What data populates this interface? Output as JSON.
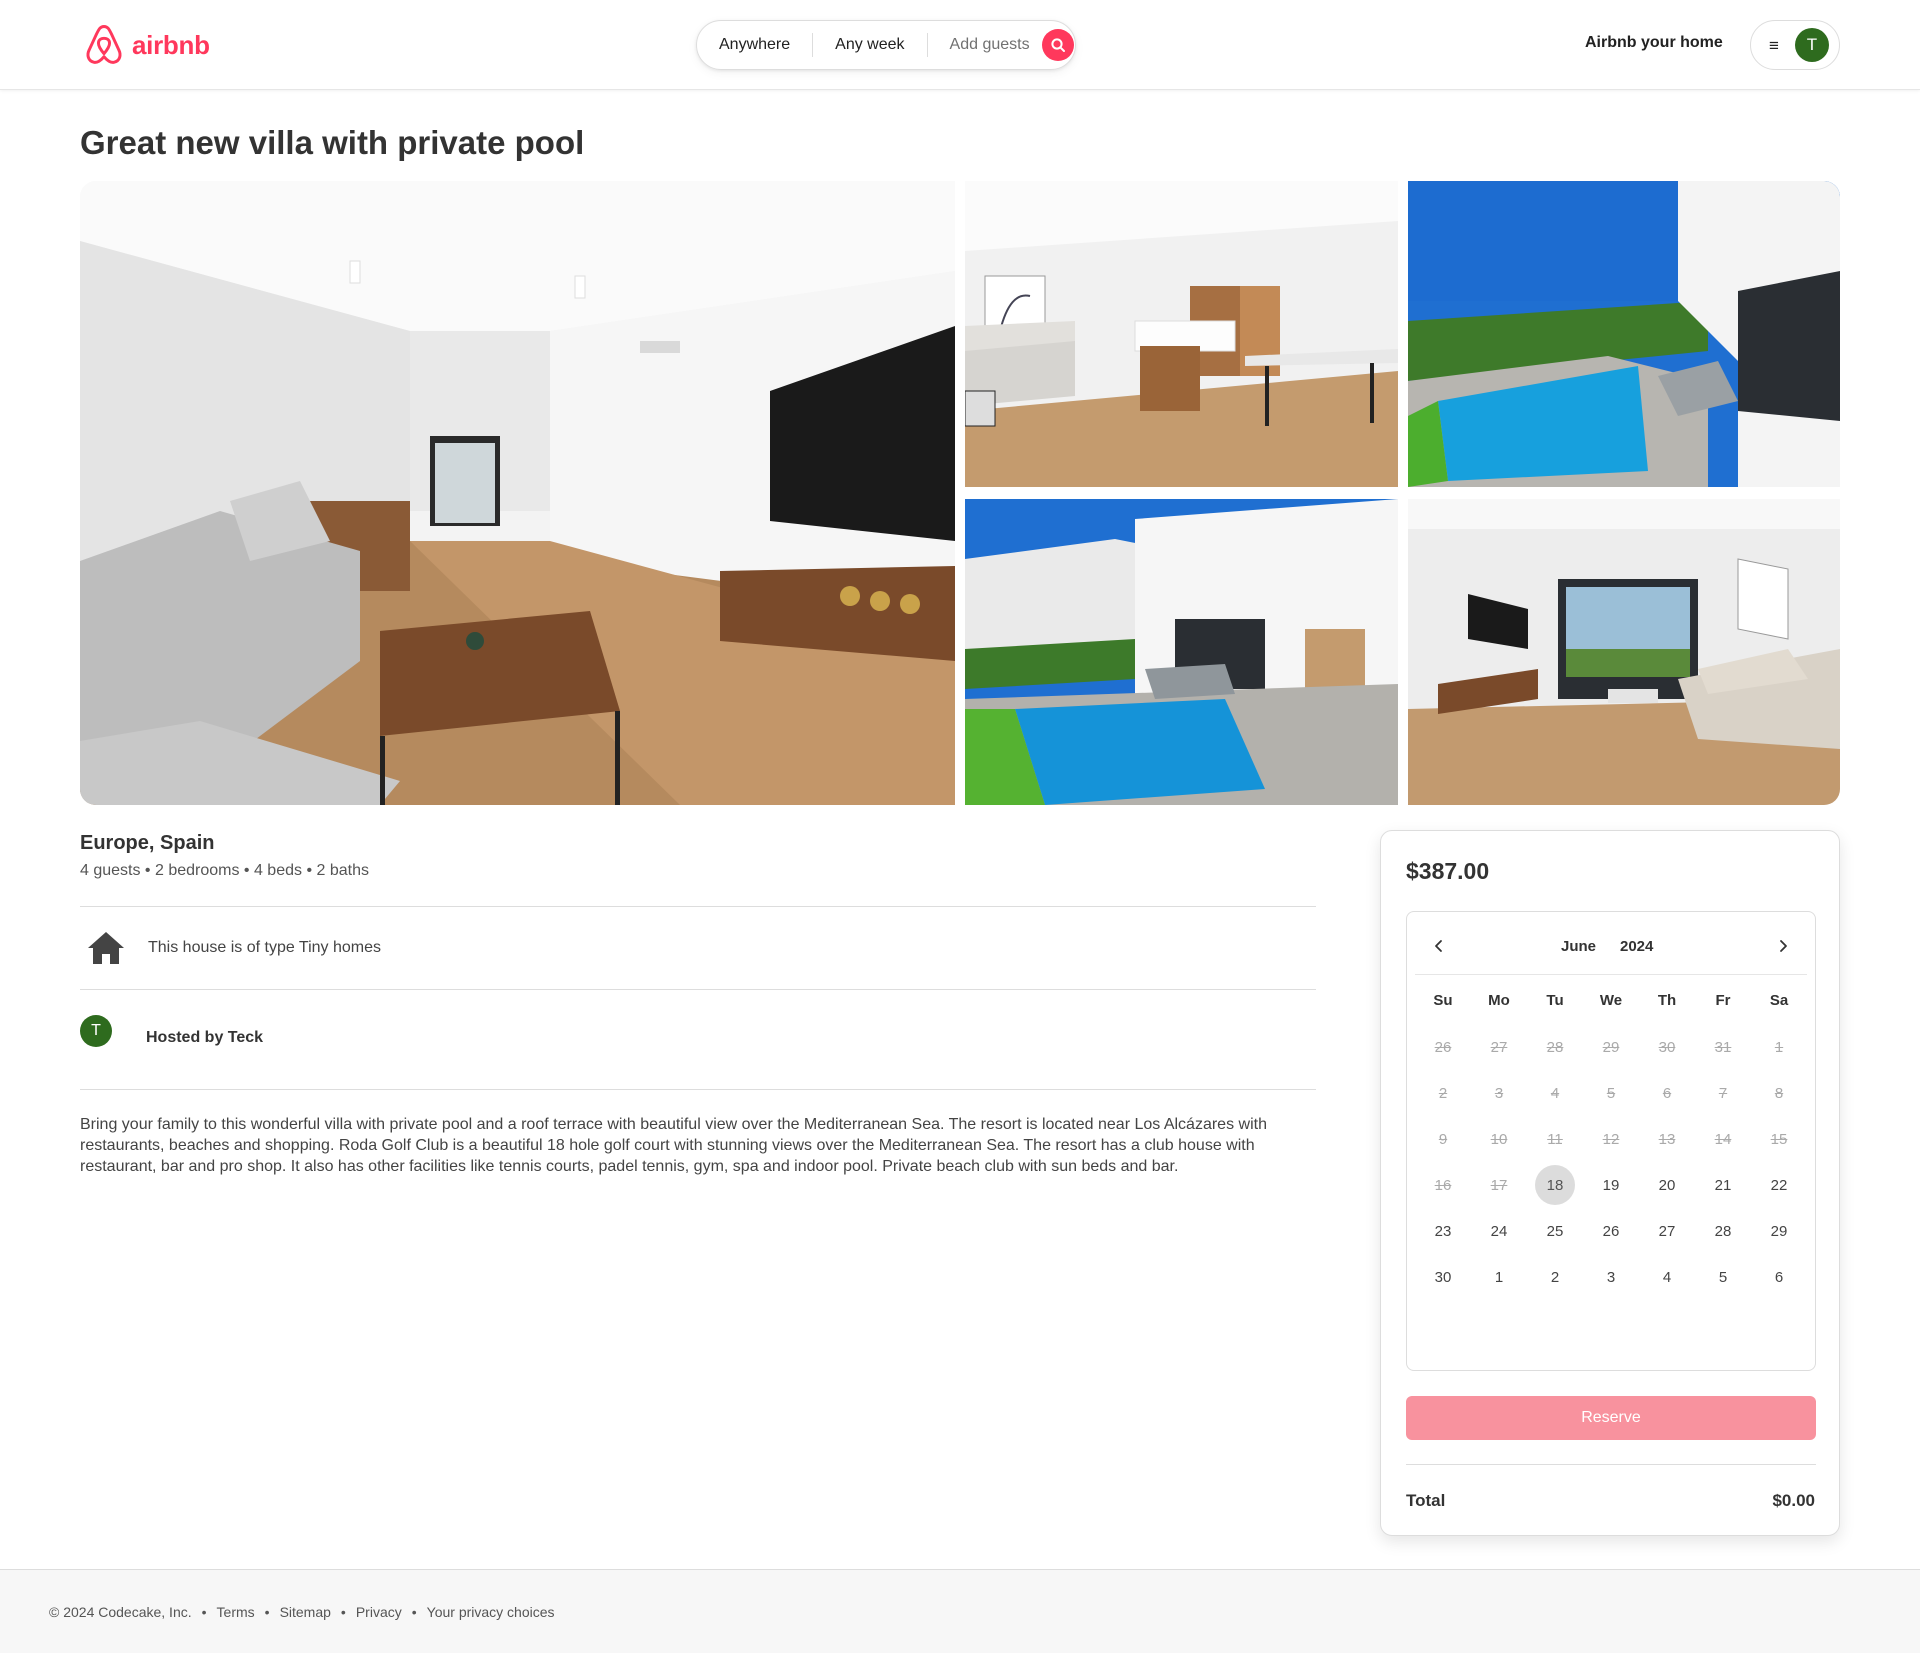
{
  "header": {
    "logo_text": "airbnb",
    "search": {
      "anywhere": "Anywhere",
      "any_week": "Any week",
      "add_guests": "Add guests"
    },
    "host_link": "Airbnb your home",
    "menu_icon": "≡",
    "avatar_initial": "T"
  },
  "listing": {
    "title": "Great new villa with private pool",
    "location": "Europe, Spain",
    "stats": "4 guests • 2 bedrooms • 4 beds • 2 baths",
    "house_type_text": "This house is of type Tiny homes",
    "host_initial": "T",
    "hosted_by": "Hosted by Teck",
    "description": "Bring your family to this wonderful villa with private pool and a roof terrace with beautiful view over the Mediterranean Sea. The resort is located near Los Alcázares with restaurants, beaches and shopping. Roda Golf Club is a beautiful 18 hole golf court with stunning views over the Mediterranean Sea. The resort has a club house with restaurant, bar and pro shop. It also has other facilities like tennis courts, padel tennis, gym, spa and indoor pool. Private beach club with sun beds and bar."
  },
  "photos": [
    {
      "name": "living-room-photo"
    },
    {
      "name": "kitchen-dining-photo"
    },
    {
      "name": "pool-terrace-photo"
    },
    {
      "name": "villa-exterior-pool-photo"
    },
    {
      "name": "lounge-photo"
    }
  ],
  "booking": {
    "price": "$387.00",
    "calendar": {
      "month": "June",
      "year": "2024",
      "weekdays": [
        "Su",
        "Mo",
        "Tu",
        "We",
        "Th",
        "Fr",
        "Sa"
      ],
      "weeks": [
        [
          {
            "d": "26",
            "off": true
          },
          {
            "d": "27",
            "off": true
          },
          {
            "d": "28",
            "off": true
          },
          {
            "d": "29",
            "off": true
          },
          {
            "d": "30",
            "off": true
          },
          {
            "d": "31",
            "off": true
          },
          {
            "d": "1",
            "off": true
          }
        ],
        [
          {
            "d": "2",
            "off": true
          },
          {
            "d": "3",
            "off": true
          },
          {
            "d": "4",
            "off": true
          },
          {
            "d": "5",
            "off": true
          },
          {
            "d": "6",
            "off": true
          },
          {
            "d": "7",
            "off": true
          },
          {
            "d": "8",
            "off": true
          }
        ],
        [
          {
            "d": "9",
            "off": true
          },
          {
            "d": "10",
            "off": true
          },
          {
            "d": "11",
            "off": true
          },
          {
            "d": "12",
            "off": true
          },
          {
            "d": "13",
            "off": true
          },
          {
            "d": "14",
            "off": true
          },
          {
            "d": "15",
            "off": true
          }
        ],
        [
          {
            "d": "16",
            "off": true
          },
          {
            "d": "17",
            "off": true
          },
          {
            "d": "18",
            "off": false,
            "selected": true
          },
          {
            "d": "19",
            "off": false
          },
          {
            "d": "20",
            "off": false
          },
          {
            "d": "21",
            "off": false
          },
          {
            "d": "22",
            "off": false
          }
        ],
        [
          {
            "d": "23",
            "off": false
          },
          {
            "d": "24",
            "off": false
          },
          {
            "d": "25",
            "off": false
          },
          {
            "d": "26",
            "off": false
          },
          {
            "d": "27",
            "off": false
          },
          {
            "d": "28",
            "off": false
          },
          {
            "d": "29",
            "off": false
          }
        ],
        [
          {
            "d": "30",
            "off": false
          },
          {
            "d": "1",
            "off": false
          },
          {
            "d": "2",
            "off": false
          },
          {
            "d": "3",
            "off": false
          },
          {
            "d": "4",
            "off": false
          },
          {
            "d": "5",
            "off": false
          },
          {
            "d": "6",
            "off": false
          }
        ]
      ]
    },
    "reserve_label": "Reserve",
    "total_label": "Total",
    "total_value": "$0.00"
  },
  "footer": {
    "copyright": "© 2024 Codecake, Inc.",
    "links": [
      "Terms",
      "Sitemap",
      "Privacy",
      "Your privacy choices"
    ],
    "separator": "•"
  },
  "colors": {
    "brand": "#FF385C",
    "reserve_button": "#F8929E",
    "avatar": "#2e6b1e"
  },
  "icons": {
    "logo": "airbnb-logo-icon",
    "search": "search-icon",
    "menu": "hamburger-menu-icon",
    "house": "house-icon",
    "prev": "chevron-left-icon",
    "next": "chevron-right-icon"
  }
}
